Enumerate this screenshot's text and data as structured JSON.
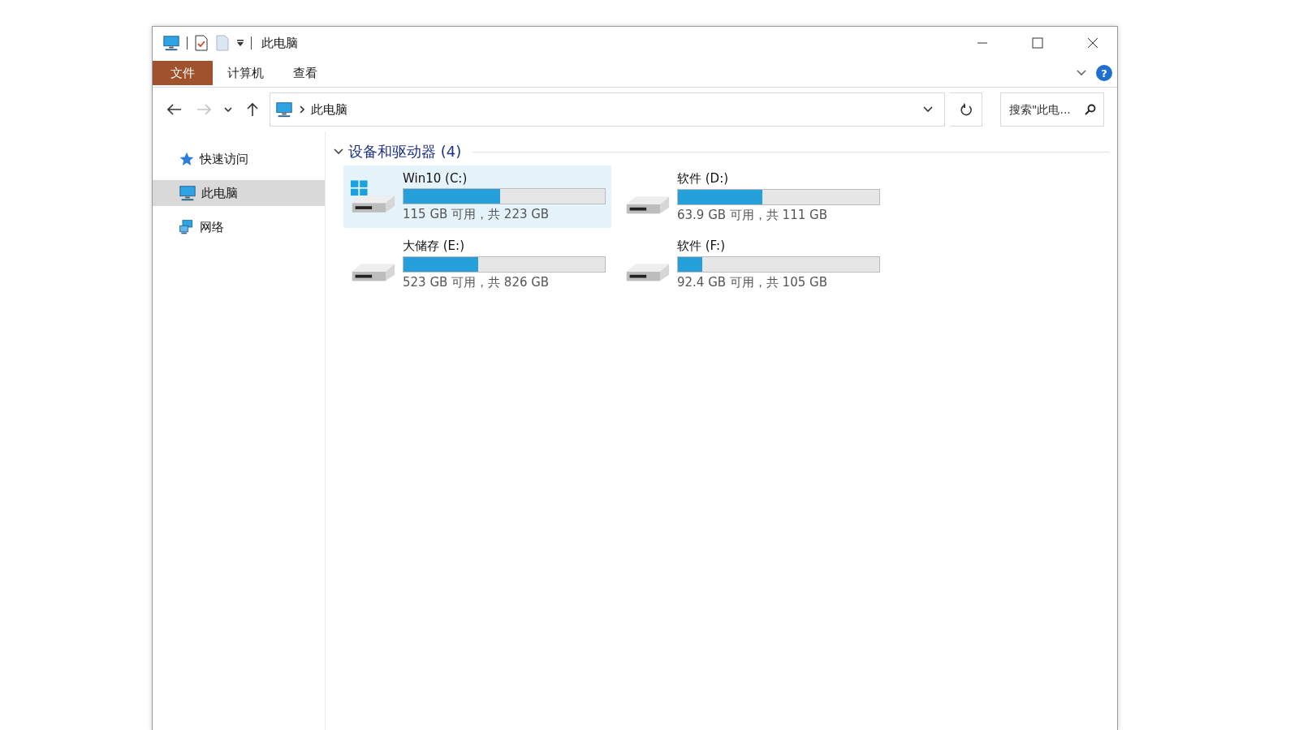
{
  "window": {
    "title": "此电脑"
  },
  "ribbon_tabs": [
    {
      "label": "文件",
      "selected": true
    },
    {
      "label": "计算机",
      "selected": false
    },
    {
      "label": "查看",
      "selected": false
    }
  ],
  "help_button": "?",
  "address_bar": {
    "path": "此电脑"
  },
  "search": {
    "placeholder": "搜索\"此电..."
  },
  "sidebar": {
    "items": [
      {
        "label": "快速访问",
        "kind": "star",
        "selected": false
      },
      {
        "label": "此电脑",
        "kind": "pc",
        "selected": true
      },
      {
        "label": "网络",
        "kind": "network",
        "selected": false
      }
    ]
  },
  "section": {
    "title": "设备和驱动器 (4)",
    "expanded": true
  },
  "drives": [
    {
      "name": "Win10 (C:)",
      "system": true,
      "selected": true,
      "level": 0.48,
      "info": "115 GB 可用，共 223 GB"
    },
    {
      "name": "软件 (D:)",
      "system": false,
      "selected": false,
      "level": 0.42,
      "info": "63.9 GB 可用，共 111 GB"
    },
    {
      "name": "大储存 (E:)",
      "system": false,
      "selected": false,
      "level": 0.37,
      "info": "523 GB 可用，共 826 GB"
    },
    {
      "name": "软件 (F:)",
      "system": false,
      "selected": false,
      "level": 0.12,
      "info": "92.4 GB 可用，共 105 GB"
    }
  ]
}
